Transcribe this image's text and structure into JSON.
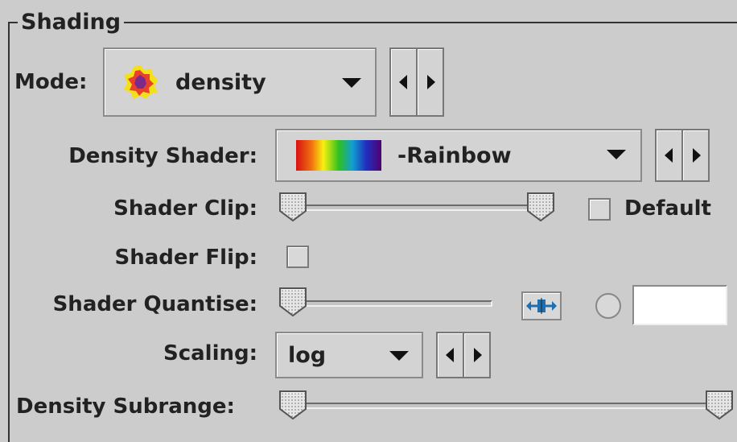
{
  "panel": {
    "title": "Shading"
  },
  "mode": {
    "label": "Mode:",
    "value": "density",
    "icon": "density-icon"
  },
  "density_shader": {
    "label": "Density Shader:",
    "value": "-Rainbow",
    "icon": "rainbow-swatch-icon"
  },
  "shader_clip": {
    "label": "Shader Clip:",
    "low": 0.0,
    "high": 1.0,
    "default_label": "Default",
    "default_checked": false
  },
  "shader_flip": {
    "label": "Shader Flip:",
    "checked": false
  },
  "shader_quantise": {
    "label": "Shader Quantise:",
    "value": 0.0,
    "radio_selected": false,
    "text_value": ""
  },
  "scaling": {
    "label": "Scaling:",
    "value": "log"
  },
  "density_subrange": {
    "label": "Density Subrange:",
    "low": 0.0,
    "high": 1.0
  },
  "colors": {
    "background": "#cccccc",
    "text": "#222222"
  }
}
